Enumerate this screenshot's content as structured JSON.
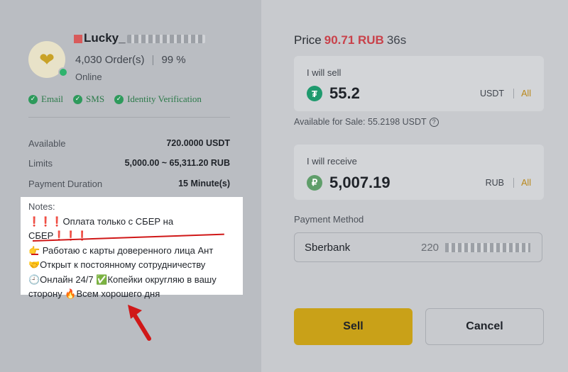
{
  "merchant": {
    "name_visible": "Lucky_",
    "orders": "4,030 Order(s)",
    "completion": "99 %",
    "status": "Online",
    "verifications": [
      "Email",
      "SMS",
      "Identity Verification"
    ]
  },
  "details": [
    {
      "label": "Available",
      "value": "720.0000 USDT"
    },
    {
      "label": "Limits",
      "value": "5,000.00 ~ 65,311.20 RUB"
    },
    {
      "label": "Payment Duration",
      "value": "15 Minute(s)"
    }
  ],
  "notes": {
    "label": "Notes:",
    "lines": [
      "❗❗❗Оплата только с СБЕР на СБЕР❗❗❗",
      "👉 Работаю с карты доверенного лица Ант",
      "🤝Открыт к постоянному сотрудничеству",
      "🕘Онлайн 24/7 ✅Копейки округляю в вашу",
      "сторону 🔥Всем хорошего дня"
    ]
  },
  "order": {
    "price_label": "Price",
    "price_value": "90.71 RUB",
    "countdown": "36s",
    "sell_label": "I will sell",
    "sell_amount": "55.2",
    "sell_currency": "USDT",
    "sell_all": "All",
    "available_text": "Available for Sale: 55.2198 USDT",
    "receive_label": "I will receive",
    "receive_amount": "5,007.19",
    "receive_currency": "RUB",
    "receive_all": "All",
    "payment_method_label": "Payment Method",
    "payment_method_name": "Sberbank",
    "payment_number_prefix": "220"
  },
  "buttons": {
    "sell": "Sell",
    "cancel": "Cancel"
  },
  "colors": {
    "price": "#c9414a",
    "sell_button": "#c9a118",
    "verified": "#2e9a5c",
    "annotation": "#d01818"
  }
}
